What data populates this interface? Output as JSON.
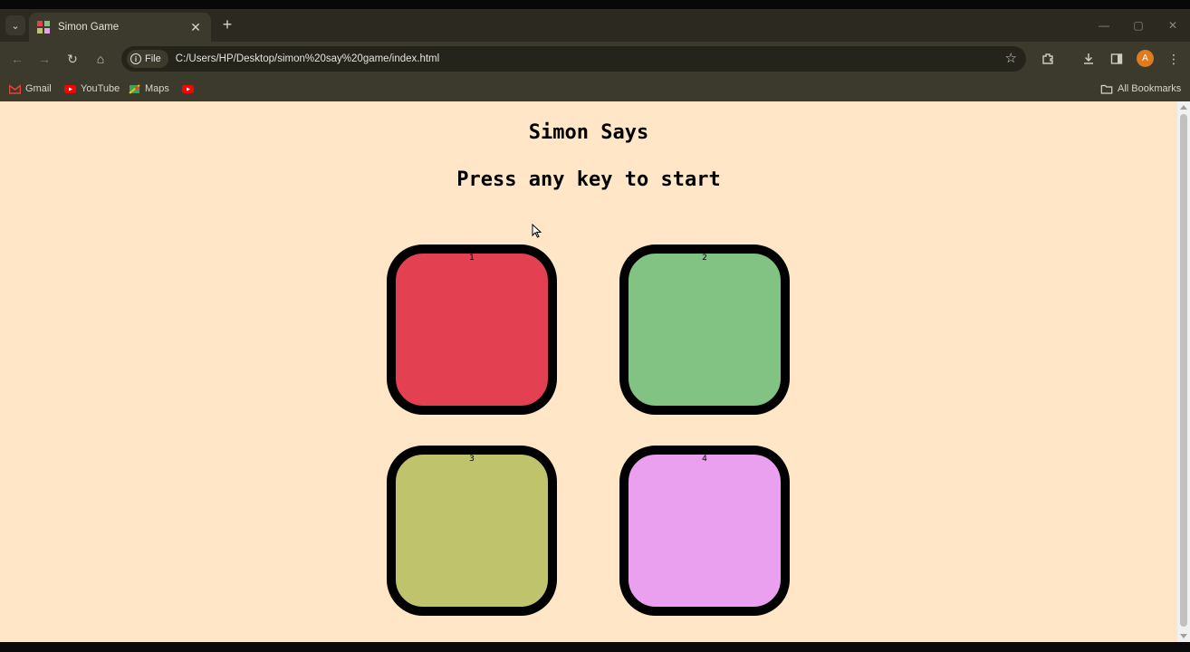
{
  "browser": {
    "tab": {
      "title": "Simon Game",
      "close": "✕"
    },
    "new_tab": "+",
    "window_controls": {
      "minimize": "—",
      "maximize": "▢",
      "close": "✕"
    },
    "nav": {
      "back": "←",
      "forward": "→",
      "reload": "↻",
      "home": "⌂"
    },
    "omnibox": {
      "site_chip": "File",
      "url": "C:/Users/HP/Desktop/simon%20say%20game/index.html"
    },
    "bookmarks": [
      {
        "label": "Gmail",
        "color": "#ea4335"
      },
      {
        "label": "YouTube",
        "color": "#ff0000"
      },
      {
        "label": "Maps",
        "color": "#34a853"
      },
      {
        "label": "",
        "color": "#ff0000"
      }
    ],
    "all_bookmarks": "All Bookmarks",
    "profile_initial": "A"
  },
  "page": {
    "title": "Simon Says",
    "level_text": "Press any key to start",
    "background": "#ffe6c7",
    "buttons": [
      {
        "label": "1",
        "color": "#e34152"
      },
      {
        "label": "2",
        "color": "#82c282"
      },
      {
        "label": "3",
        "color": "#bfc46c"
      },
      {
        "label": "4",
        "color": "#eb9fef"
      }
    ]
  }
}
